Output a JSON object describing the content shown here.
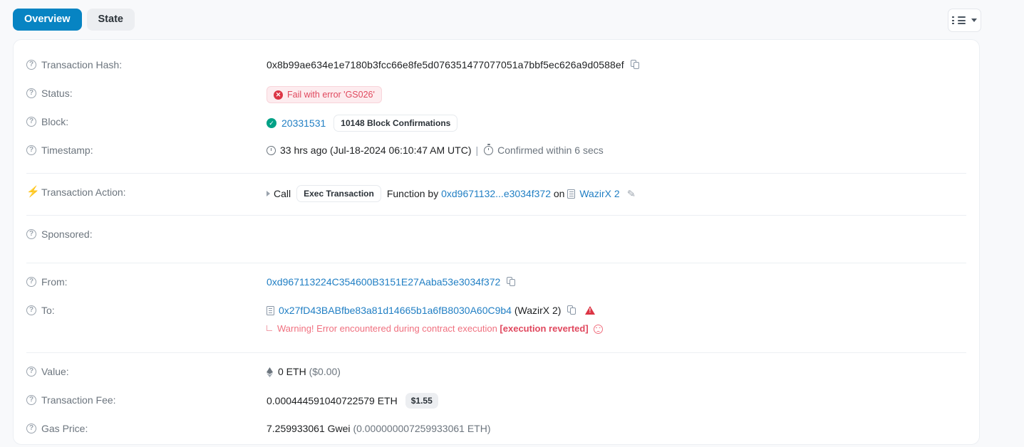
{
  "tabs": [
    {
      "label": "Overview",
      "active": true
    },
    {
      "label": "State",
      "active": false
    }
  ],
  "toolbar": {
    "list_toggle_name": "list-view-dropdown"
  },
  "rows": {
    "transaction_hash": {
      "label": "Transaction Hash:",
      "value": "0x8b99ae634e1e7180b3fcc66e8fe5d076351477077051a7bbf5ec626a9d0588ef"
    },
    "status": {
      "label": "Status:",
      "badge": "Fail with error 'GS026'"
    },
    "block": {
      "label": "Block:",
      "number": "20331531",
      "confirmations": "10148 Block Confirmations"
    },
    "timestamp": {
      "label": "Timestamp:",
      "age": "33 hrs ago (Jul-18-2024 06:10:47 AM UTC)",
      "separator": "|",
      "confirmed": "Confirmed within 6 secs"
    },
    "transaction_action": {
      "label": "Transaction Action:",
      "call_word": "Call",
      "function_badge": "Exec Transaction",
      "function_by": "Function by",
      "caller": "0xd9671132...e3034f372",
      "on_word": "on",
      "contract": "WazirX 2"
    },
    "sponsored": {
      "label": "Sponsored:"
    },
    "from": {
      "label": "From:",
      "address": "0xd967113224C354600B3151E27Aaba53e3034f372"
    },
    "to": {
      "label": "To:",
      "address": "0x27fD43BABfbe83a81d14665b1a6fB8030A60C9b4",
      "tag": "(WazirX 2)",
      "warning_prefix": "Warning! Error encountered during contract execution",
      "warning_bold": "[execution reverted]"
    },
    "value": {
      "label": "Value:",
      "amount": "0 ETH",
      "usd": "($0.00)"
    },
    "transaction_fee": {
      "label": "Transaction Fee:",
      "amount": "0.000444591040722579 ETH",
      "usd_badge": "$1.55"
    },
    "gas_price": {
      "label": "Gas Price:",
      "gwei": "7.259933061 Gwei",
      "eth": "(0.000000007259933061 ETH)"
    }
  },
  "colors": {
    "accent": "#0784c3",
    "link": "#217fc4",
    "fail": "#dc3545",
    "success": "#00a186",
    "muted": "#6c757e"
  }
}
